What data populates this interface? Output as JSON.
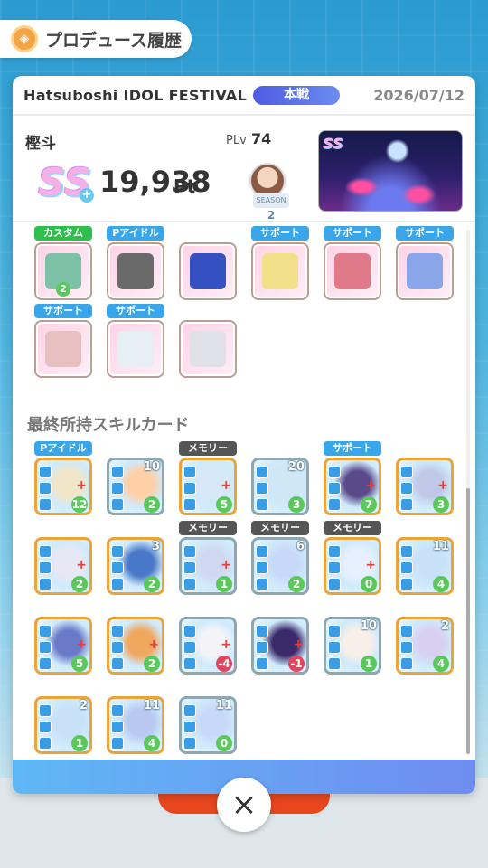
{
  "header": {
    "title": "プロデュース履歴",
    "icon": "produce-icon"
  },
  "event": {
    "name": "Hatsuboshi IDOL FESTIVAL",
    "badge": "本戦",
    "date": "2026/07/12"
  },
  "idol": {
    "name": "樫斗",
    "plv_label": "PLv",
    "plv_value": "74",
    "rank": "SS",
    "rank_plus": "+",
    "score": "19,938",
    "score_unit": "Pt",
    "season_text": "SEASON",
    "season_num": "2"
  },
  "items": [
    {
      "tag": "カスタム",
      "tag_color": "green",
      "icon": "backpack-icon",
      "num": "2"
    },
    {
      "tag": "Pアイドル",
      "tag_color": "blue",
      "icon": "photo-icon"
    },
    {
      "tag": "",
      "icon": "star-badge-icon"
    },
    {
      "tag": "サポート",
      "tag_color": "blue",
      "icon": "cup-icon"
    },
    {
      "tag": "サポート",
      "tag_color": "blue",
      "icon": "book-icon"
    },
    {
      "tag": "サポート",
      "tag_color": "blue",
      "icon": "cards-icon"
    },
    {
      "tag": "サポート",
      "tag_color": "blue",
      "icon": "gift-icon"
    },
    {
      "tag": "サポート",
      "tag_color": "blue",
      "icon": "skates-icon"
    },
    {
      "tag": "",
      "icon": "socks-icon"
    }
  ],
  "section_title": "最終所持スキルカード",
  "cards": [
    {
      "tag": "Pアイドル",
      "tag_color": "blue",
      "lvl": "",
      "cost": "12",
      "cost_color": "green",
      "border": "gold"
    },
    {
      "tag": "",
      "lvl": "10",
      "cost": "2",
      "cost_color": "green",
      "border": "silver"
    },
    {
      "tag": "メモリー",
      "tag_color": "dark",
      "lvl": "",
      "cost": "5",
      "cost_color": "green",
      "border": "gold"
    },
    {
      "tag": "",
      "lvl": "20",
      "cost": "3",
      "cost_color": "green",
      "border": "silver"
    },
    {
      "tag": "サポート",
      "tag_color": "blue",
      "lvl": "",
      "cost": "7",
      "cost_color": "green",
      "border": "gold"
    },
    {
      "tag": "",
      "lvl": "",
      "cost": "3",
      "cost_color": "green",
      "border": "gold"
    },
    {
      "tag": "",
      "lvl": "",
      "cost": "2",
      "cost_color": "green",
      "border": "gold"
    },
    {
      "tag": "",
      "lvl": "3",
      "cost": "2",
      "cost_color": "green",
      "border": "gold"
    },
    {
      "tag": "メモリー",
      "tag_color": "dark",
      "lvl": "",
      "cost": "1",
      "cost_color": "green",
      "border": "silver"
    },
    {
      "tag": "メモリー",
      "tag_color": "dark",
      "lvl": "6",
      "cost": "2",
      "cost_color": "green",
      "border": "silver"
    },
    {
      "tag": "メモリー",
      "tag_color": "dark",
      "lvl": "",
      "cost": "0",
      "cost_color": "green",
      "border": "gold"
    },
    {
      "tag": "",
      "lvl": "11",
      "cost": "4",
      "cost_color": "green",
      "border": "gold"
    },
    {
      "tag": "",
      "lvl": "",
      "cost": "5",
      "cost_color": "green",
      "border": "gold"
    },
    {
      "tag": "",
      "lvl": "",
      "cost": "2",
      "cost_color": "green",
      "border": "gold"
    },
    {
      "tag": "",
      "lvl": "",
      "cost": "4",
      "cost_color": "red",
      "border": "silver"
    },
    {
      "tag": "",
      "lvl": "",
      "cost": "1",
      "cost_color": "red",
      "border": "silver"
    },
    {
      "tag": "",
      "lvl": "10",
      "cost": "1",
      "cost_color": "green",
      "border": "silver"
    },
    {
      "tag": "",
      "lvl": "2",
      "cost": "4",
      "cost_color": "green",
      "border": "gold"
    },
    {
      "tag": "",
      "lvl": "2",
      "cost": "1",
      "cost_color": "green",
      "border": "gold"
    },
    {
      "tag": "",
      "lvl": "11",
      "cost": "4",
      "cost_color": "green",
      "border": "gold"
    },
    {
      "tag": "",
      "lvl": "11",
      "cost": "0",
      "cost_color": "green",
      "border": "silver"
    }
  ],
  "close_label": "×"
}
